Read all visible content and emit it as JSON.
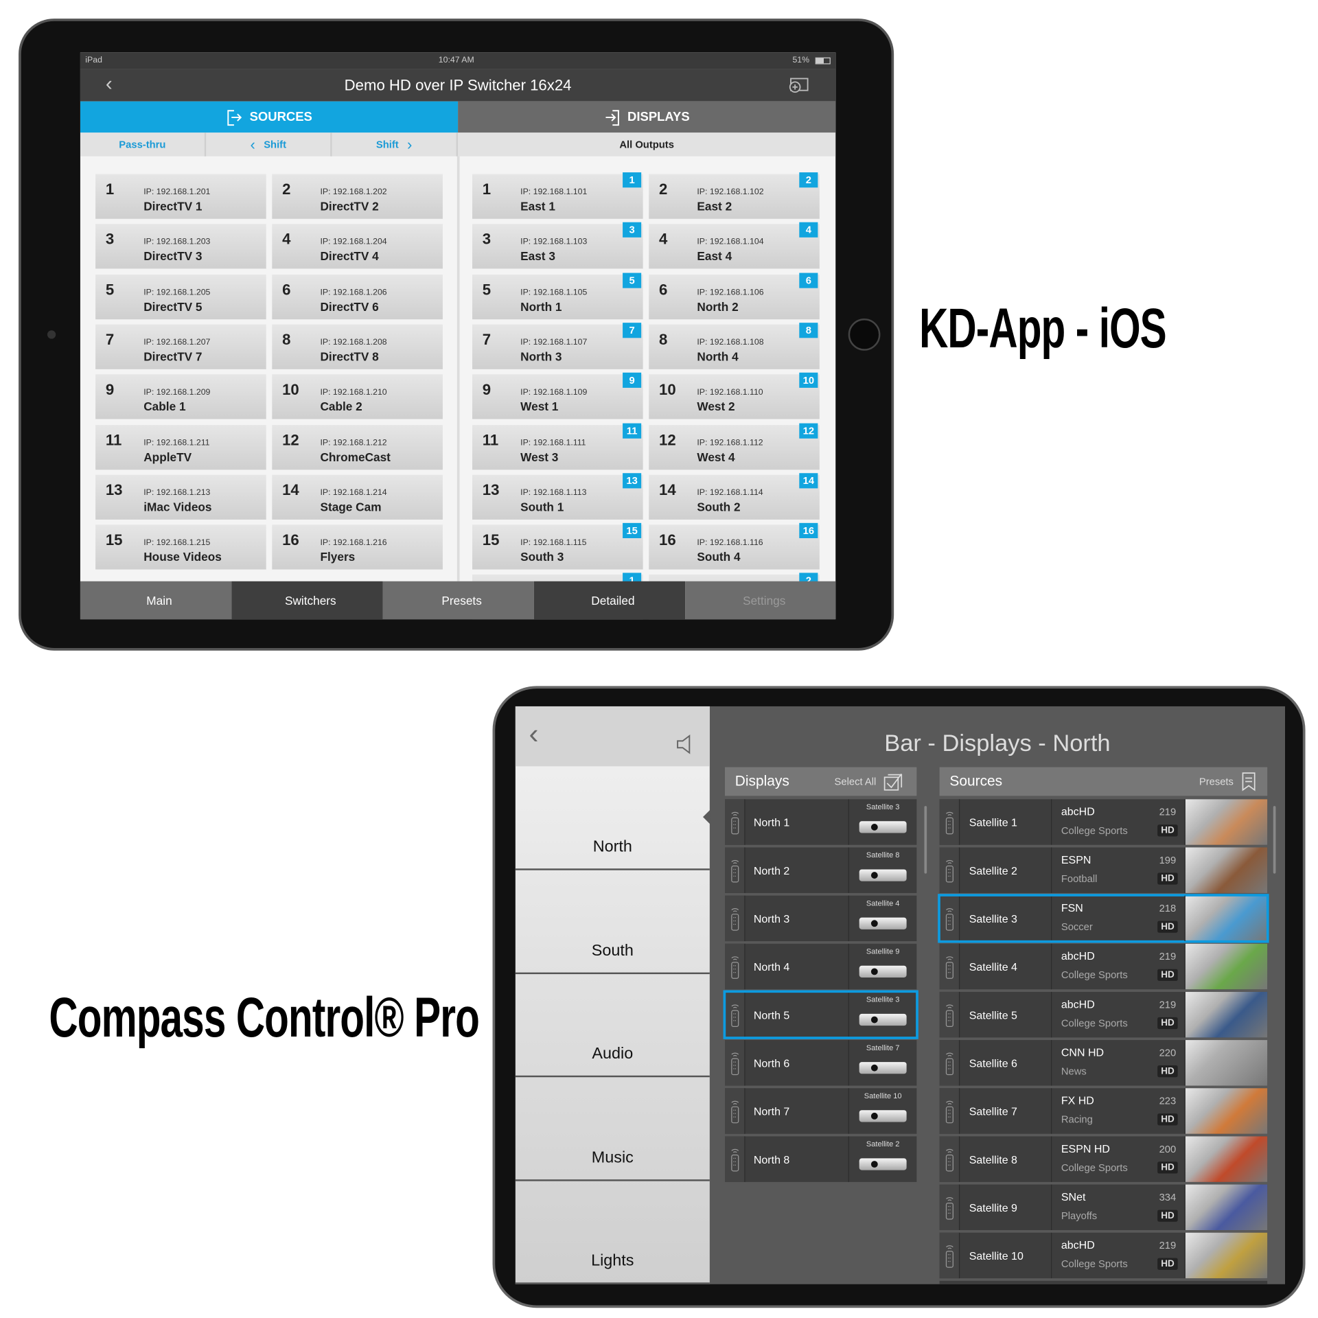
{
  "kd": {
    "label": "KD-App - iOS",
    "status": {
      "device": "iPad",
      "time": "10:47 AM",
      "battery": "51%"
    },
    "title": "Demo HD over IP Switcher 16x24",
    "tabs": {
      "sources": "SOURCES",
      "displays": "DISPLAYS"
    },
    "sources_sub": {
      "passthru": "Pass-thru",
      "shift_left": "Shift",
      "shift_right": "Shift"
    },
    "displays_sub": "All Outputs",
    "sources": [
      {
        "n": "1",
        "ip": "IP: 192.168.1.201",
        "name": "DirectTV 1"
      },
      {
        "n": "2",
        "ip": "IP: 192.168.1.202",
        "name": "DirectTV 2"
      },
      {
        "n": "3",
        "ip": "IP: 192.168.1.203",
        "name": "DirectTV 3"
      },
      {
        "n": "4",
        "ip": "IP: 192.168.1.204",
        "name": "DirectTV 4"
      },
      {
        "n": "5",
        "ip": "IP: 192.168.1.205",
        "name": "DirectTV 5"
      },
      {
        "n": "6",
        "ip": "IP: 192.168.1.206",
        "name": "DirectTV 6"
      },
      {
        "n": "7",
        "ip": "IP: 192.168.1.207",
        "name": "DirectTV 7"
      },
      {
        "n": "8",
        "ip": "IP: 192.168.1.208",
        "name": "DirectTV 8"
      },
      {
        "n": "9",
        "ip": "IP: 192.168.1.209",
        "name": "Cable 1"
      },
      {
        "n": "10",
        "ip": "IP: 192.168.1.210",
        "name": "Cable 2"
      },
      {
        "n": "11",
        "ip": "IP: 192.168.1.211",
        "name": "AppleTV"
      },
      {
        "n": "12",
        "ip": "IP: 192.168.1.212",
        "name": "ChromeCast"
      },
      {
        "n": "13",
        "ip": "IP: 192.168.1.213",
        "name": "iMac Videos"
      },
      {
        "n": "14",
        "ip": "IP: 192.168.1.214",
        "name": "Stage Cam"
      },
      {
        "n": "15",
        "ip": "IP: 192.168.1.215",
        "name": "House Videos"
      },
      {
        "n": "16",
        "ip": "IP: 192.168.1.216",
        "name": "Flyers"
      }
    ],
    "displays": [
      {
        "n": "1",
        "ip": "IP: 192.168.1.101",
        "name": "East 1",
        "badge": "1"
      },
      {
        "n": "2",
        "ip": "IP: 192.168.1.102",
        "name": "East 2",
        "badge": "2"
      },
      {
        "n": "3",
        "ip": "IP: 192.168.1.103",
        "name": "East 3",
        "badge": "3"
      },
      {
        "n": "4",
        "ip": "IP: 192.168.1.104",
        "name": "East 4",
        "badge": "4"
      },
      {
        "n": "5",
        "ip": "IP: 192.168.1.105",
        "name": "North 1",
        "badge": "5"
      },
      {
        "n": "6",
        "ip": "IP: 192.168.1.106",
        "name": "North 2",
        "badge": "6"
      },
      {
        "n": "7",
        "ip": "IP: 192.168.1.107",
        "name": "North 3",
        "badge": "7"
      },
      {
        "n": "8",
        "ip": "IP: 192.168.1.108",
        "name": "North 4",
        "badge": "8"
      },
      {
        "n": "9",
        "ip": "IP: 192.168.1.109",
        "name": "West 1",
        "badge": "9"
      },
      {
        "n": "10",
        "ip": "IP: 192.168.1.110",
        "name": "West 2",
        "badge": "10"
      },
      {
        "n": "11",
        "ip": "IP: 192.168.1.111",
        "name": "West 3",
        "badge": "11"
      },
      {
        "n": "12",
        "ip": "IP: 192.168.1.112",
        "name": "West 4",
        "badge": "12"
      },
      {
        "n": "13",
        "ip": "IP: 192.168.1.113",
        "name": "South 1",
        "badge": "13"
      },
      {
        "n": "14",
        "ip": "IP: 192.168.1.114",
        "name": "South 2",
        "badge": "14"
      },
      {
        "n": "15",
        "ip": "IP: 192.168.1.115",
        "name": "South 3",
        "badge": "15"
      },
      {
        "n": "16",
        "ip": "IP: 192.168.1.116",
        "name": "South 4",
        "badge": "16"
      },
      {
        "n": "",
        "ip": "",
        "name": "",
        "badge": "1"
      },
      {
        "n": "",
        "ip": "",
        "name": "",
        "badge": "2"
      }
    ],
    "nav": [
      {
        "label": "Main",
        "icon": "home-icon",
        "bg": "#6d6d6d"
      },
      {
        "label": "Switchers",
        "icon": "shuffle-icon",
        "bg": "#3e3e3e"
      },
      {
        "label": "Presets",
        "icon": "bookmark-icon",
        "bg": "#6d6d6d"
      },
      {
        "label": "Detailed",
        "icon": "expand-icon",
        "bg": "#3e3e3e"
      },
      {
        "label": "Settings",
        "icon": "sliders-icon",
        "bg": "#6d6d6d",
        "disabled": true
      }
    ],
    "accent": "#12a5df"
  },
  "compass": {
    "label": "Compass Control® Pro",
    "title": "Bar - Displays - North",
    "sidebar": [
      {
        "label": "North",
        "icon": "display-stack-icon"
      },
      {
        "label": "South",
        "icon": "display-stack-icon"
      },
      {
        "label": "Audio",
        "icon": "speaker-icon"
      },
      {
        "label": "Music",
        "icon": "music-note-icon"
      },
      {
        "label": "Lights",
        "icon": "lightbulb-icon"
      }
    ],
    "displays_header": {
      "title": "Displays",
      "action": "Select All"
    },
    "sources_header": {
      "title": "Sources",
      "action": "Presets"
    },
    "displays": [
      {
        "name": "North 1",
        "source": "Satellite 3"
      },
      {
        "name": "North 2",
        "source": "Satellite 8"
      },
      {
        "name": "North 3",
        "source": "Satellite 4"
      },
      {
        "name": "North 4",
        "source": "Satellite 9"
      },
      {
        "name": "North 5",
        "source": "Satellite 3",
        "selected": true
      },
      {
        "name": "North 6",
        "source": "Satellite 7"
      },
      {
        "name": "North 7",
        "source": "Satellite 10"
      },
      {
        "name": "North 8",
        "source": "Satellite 2"
      }
    ],
    "sources": [
      {
        "name": "Satellite 1",
        "channel": "abcHD",
        "number": "219",
        "genre": "College Sports",
        "hd": "HD"
      },
      {
        "name": "Satellite 2",
        "channel": "ESPN",
        "number": "199",
        "genre": "Football",
        "hd": "HD"
      },
      {
        "name": "Satellite 3",
        "channel": "FSN",
        "number": "218",
        "genre": "Soccer",
        "hd": "HD",
        "selected": true
      },
      {
        "name": "Satellite 4",
        "channel": "abcHD",
        "number": "219",
        "genre": "College Sports",
        "hd": "HD"
      },
      {
        "name": "Satellite 5",
        "channel": "abcHD",
        "number": "219",
        "genre": "College Sports",
        "hd": "HD"
      },
      {
        "name": "Satellite 6",
        "channel": "CNN HD",
        "number": "220",
        "genre": "News",
        "hd": "HD"
      },
      {
        "name": "Satellite 7",
        "channel": "FX HD",
        "number": "223",
        "genre": "Racing",
        "hd": "HD"
      },
      {
        "name": "Satellite 8",
        "channel": "ESPN HD",
        "number": "200",
        "genre": "College Sports",
        "hd": "HD"
      },
      {
        "name": "Satellite 9",
        "channel": "SNet",
        "number": "334",
        "genre": "Playoffs",
        "hd": "HD"
      },
      {
        "name": "Satellite 10",
        "channel": "abcHD",
        "number": "219",
        "genre": "College Sports",
        "hd": "HD"
      }
    ],
    "accent": "#0d9be0"
  }
}
